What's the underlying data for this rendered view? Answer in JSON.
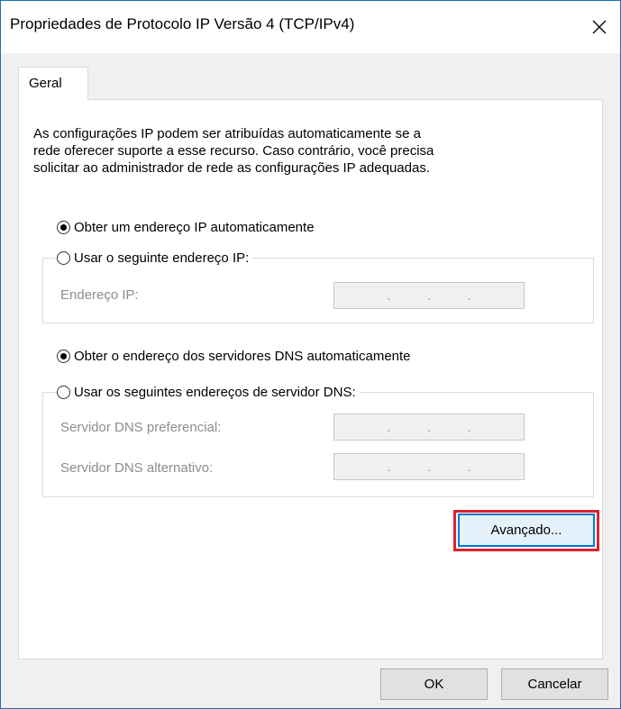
{
  "window": {
    "title": "Propriedades de Protocolo IP Versão 4 (TCP/IPv4)"
  },
  "tabs": [
    {
      "label": "Geral"
    }
  ],
  "description": [
    "As configurações IP podem ser atribuídas automaticamente se a",
    "rede oferecer suporte a esse recurso. Caso contrário, você precisa",
    "solicitar ao administrador de rede as configurações IP adequadas."
  ],
  "ip_section": {
    "auto_label": "Obter um endereço IP automaticamente",
    "manual_label": "Usar o seguinte endereço IP:",
    "selected": "auto",
    "fields": [
      {
        "label": "Endereço IP:",
        "value": ". . ."
      }
    ]
  },
  "dns_section": {
    "auto_label": "Obter o endereço dos servidores DNS automaticamente",
    "manual_label": "Usar os seguintes endereços de servidor DNS:",
    "selected": "auto",
    "fields": [
      {
        "label": "Servidor DNS preferencial:",
        "value": ". . ."
      },
      {
        "label": "Servidor DNS alternativo:",
        "value": ". . ."
      }
    ]
  },
  "buttons": {
    "advanced": "Avançado...",
    "ok": "OK",
    "cancel": "Cancelar"
  },
  "colors": {
    "highlight": "#e0222e",
    "focus_border": "#0078d7",
    "window_border": "#1a6fc0"
  }
}
